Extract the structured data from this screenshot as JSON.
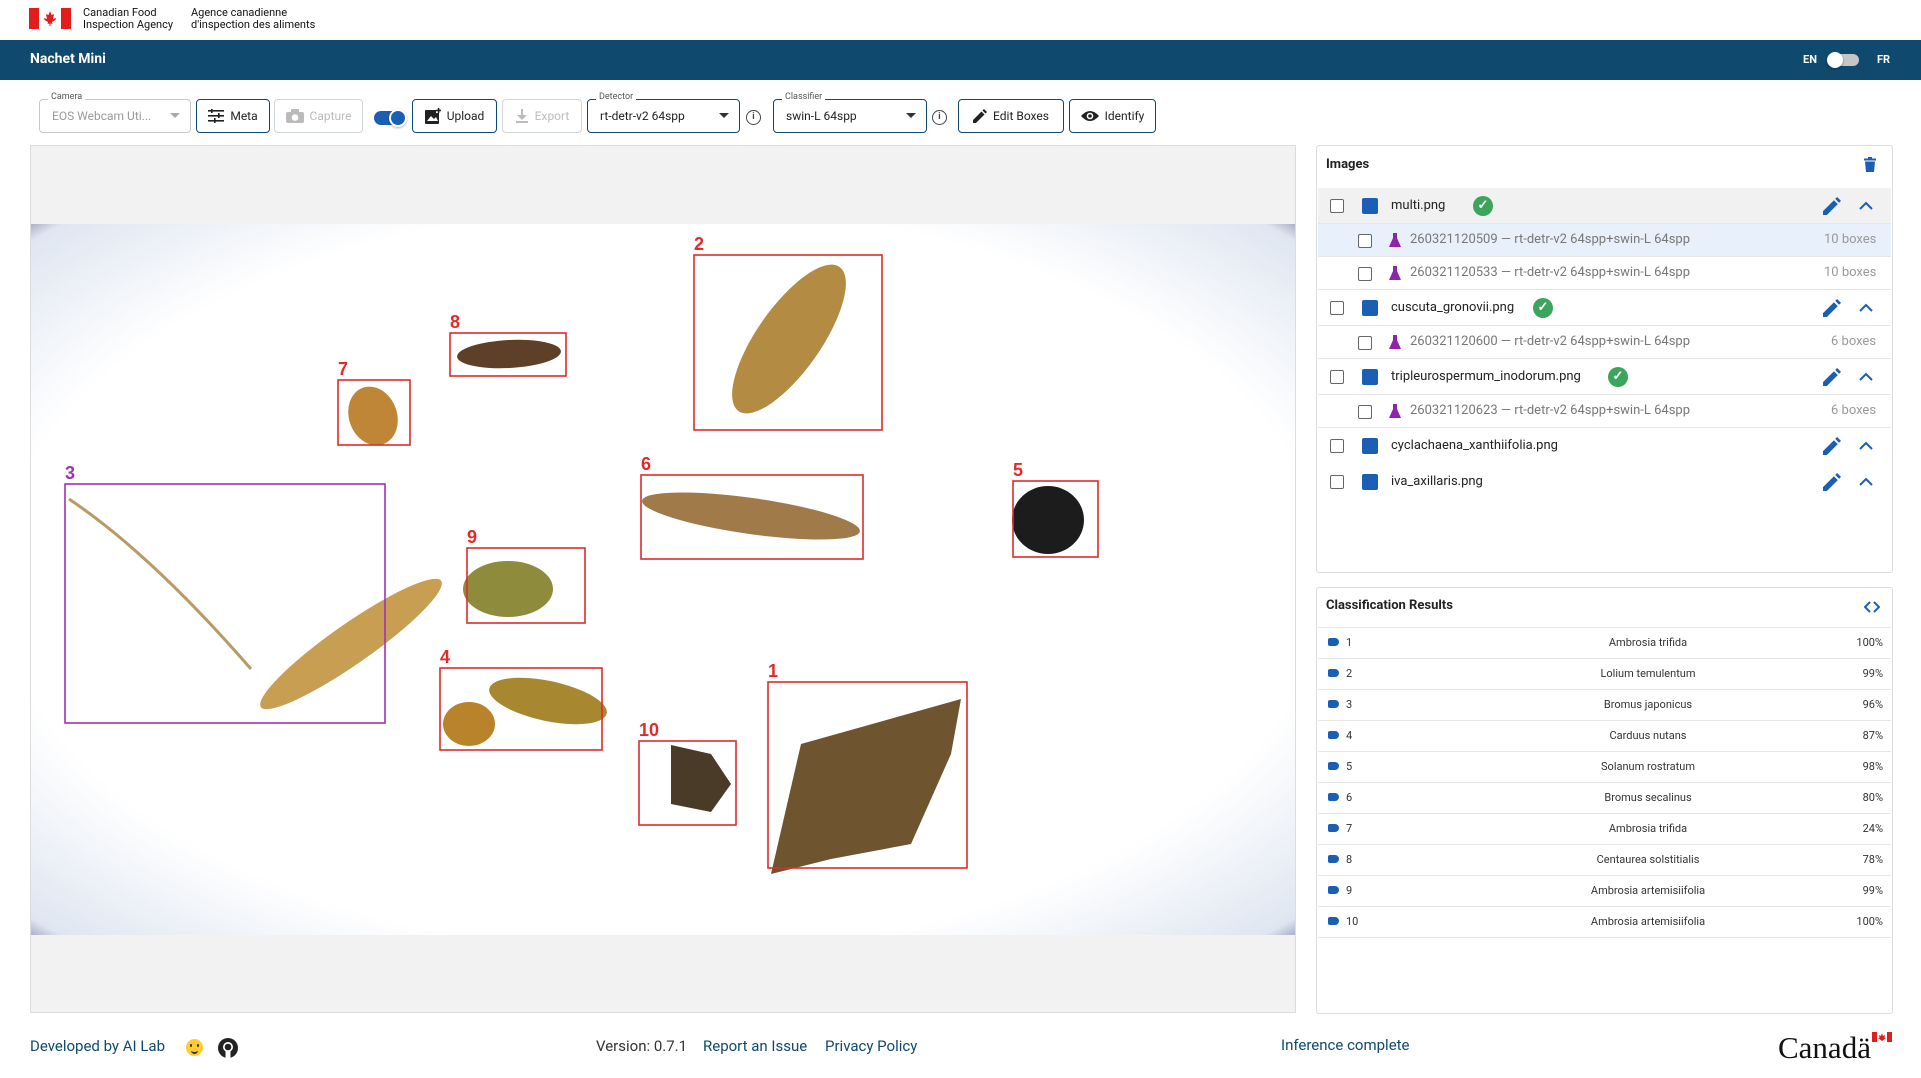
{
  "agency": {
    "name_en_line1": "Canadian Food",
    "name_en_line2": "Inspection Agency",
    "name_fr_line1": "Agence canadienne",
    "name_fr_line2": "d'inspection des aliments"
  },
  "appbar": {
    "title": "Nachet Mini",
    "lang_en": "EN",
    "lang_fr": "FR"
  },
  "toolbar": {
    "camera_label": "Camera",
    "camera_value": "EOS Webcam Uti...",
    "meta": "Meta",
    "capture": "Capture",
    "upload": "Upload",
    "export": "Export",
    "detector_label": "Detector",
    "detector_value": "rt-detr-v2 64spp",
    "classifier_label": "Classifier",
    "classifier_value": "swin-L 64spp",
    "edit_boxes": "Edit Boxes",
    "identify": "Identify",
    "info_glyph": "i"
  },
  "boxes": [
    {
      "label": "1"
    },
    {
      "label": "2"
    },
    {
      "label": "3"
    },
    {
      "label": "4"
    },
    {
      "label": "5"
    },
    {
      "label": "6"
    },
    {
      "label": "7"
    },
    {
      "label": "8"
    },
    {
      "label": "9"
    },
    {
      "label": "10"
    }
  ],
  "images_panel": {
    "title": "Images",
    "items": [
      {
        "name": "multi.png",
        "ok": "✓",
        "runs": [
          {
            "id": "260321120509 — rt-detr-v2 64spp+swin-L 64spp",
            "boxes": "10 boxes"
          },
          {
            "id": "260321120533 — rt-detr-v2 64spp+swin-L 64spp",
            "boxes": "10 boxes"
          }
        ]
      },
      {
        "name": "cuscuta_gronovii.png",
        "ok": "✓",
        "runs": [
          {
            "id": "260321120600 — rt-detr-v2 64spp+swin-L 64spp",
            "boxes": "6 boxes"
          }
        ]
      },
      {
        "name": "tripleurospermum_inodorum.png",
        "ok": "✓",
        "runs": [
          {
            "id": "260321120623 — rt-detr-v2 64spp+swin-L 64spp",
            "boxes": "6 boxes"
          }
        ]
      },
      {
        "name": "cyclachaena_xanthiifolia.png"
      },
      {
        "name": "iva_axillaris.png"
      }
    ]
  },
  "classification": {
    "title": "Classification Results",
    "rows": [
      {
        "num": "1",
        "name": "Ambrosia trifida",
        "pct": "100%"
      },
      {
        "num": "2",
        "name": "Lolium temulentum",
        "pct": "99%"
      },
      {
        "num": "3",
        "name": "Bromus japonicus",
        "pct": "96%"
      },
      {
        "num": "4",
        "name": "Carduus nutans",
        "pct": "87%"
      },
      {
        "num": "5",
        "name": "Solanum rostratum",
        "pct": "98%"
      },
      {
        "num": "6",
        "name": "Bromus secalinus",
        "pct": "80%"
      },
      {
        "num": "7",
        "name": "Ambrosia trifida",
        "pct": "24%"
      },
      {
        "num": "8",
        "name": "Centaurea solstitialis",
        "pct": "78%"
      },
      {
        "num": "9",
        "name": "Ambrosia artemisiifolia",
        "pct": "99%"
      },
      {
        "num": "10",
        "name": "Ambrosia artemisiifolia",
        "pct": "100%"
      }
    ]
  },
  "footer": {
    "developed": "Developed by AI Lab",
    "version": "Version: 0.7.1",
    "report": "Report an Issue",
    "privacy": "Privacy Policy",
    "status": "Inference complete",
    "wordmark": "Canadä"
  }
}
